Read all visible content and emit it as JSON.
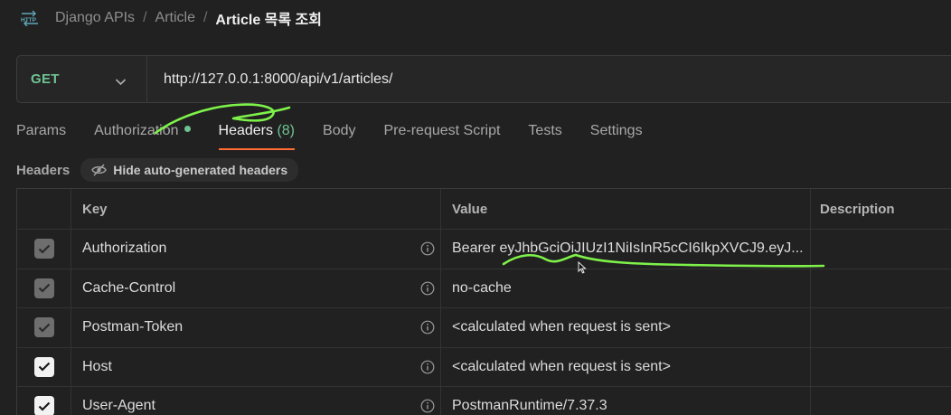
{
  "breadcrumb": {
    "workspace": "Django APIs",
    "folder": "Article",
    "separator": "/",
    "current": "Article 목록 조회",
    "icon": "http-icon"
  },
  "request": {
    "method": "GET",
    "url": "http://127.0.0.1:8000/api/v1/articles/"
  },
  "tabs": [
    {
      "label": "Params"
    },
    {
      "label": "Authorization"
    },
    {
      "label": "Headers",
      "count": "(8)"
    },
    {
      "label": "Body"
    },
    {
      "label": "Pre-request Script"
    },
    {
      "label": "Tests"
    },
    {
      "label": "Settings"
    }
  ],
  "headers_section": {
    "title": "Headers",
    "toggle_label": "Hide auto-generated headers"
  },
  "table": {
    "columns": {
      "key": "Key",
      "value": "Value",
      "description": "Description"
    },
    "rows": [
      {
        "key": "Authorization",
        "value": "Bearer eyJhbGciOiJIUzI1NiIsInR5cCI6IkpXVCJ9.eyJ...",
        "checked": "disabled"
      },
      {
        "key": "Cache-Control",
        "value": "no-cache",
        "checked": "disabled"
      },
      {
        "key": "Postman-Token",
        "value": "<calculated when request is sent>",
        "checked": "disabled"
      },
      {
        "key": "Host",
        "value": "<calculated when request is sent>",
        "checked": "enabled"
      },
      {
        "key": "User-Agent",
        "value": "PostmanRuntime/7.37.3",
        "checked": "enabled"
      }
    ]
  },
  "colors": {
    "accent": "#ff6c37",
    "method": "#6fc393",
    "annotation": "#7ef24a",
    "background": "#212121"
  }
}
